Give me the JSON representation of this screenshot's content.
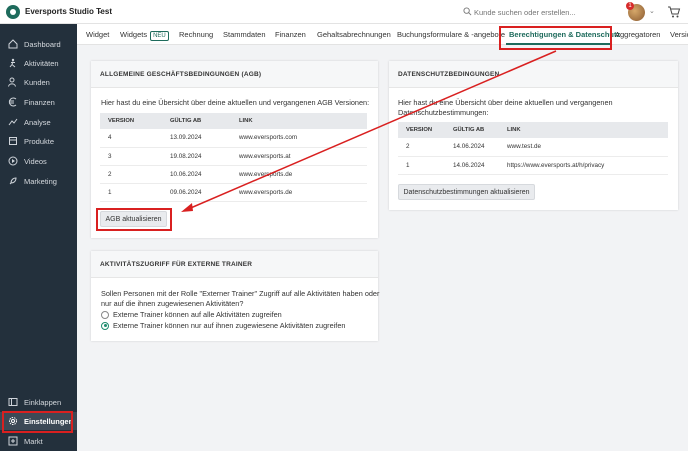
{
  "header": {
    "studio_name": "Eversports Studio Test",
    "search_placeholder": "Kunde suchen oder erstellen...",
    "notification_count": "1"
  },
  "sidebar": {
    "items": [
      {
        "label": "Dashboard",
        "icon": "home-icon"
      },
      {
        "label": "Aktivitäten",
        "icon": "activity-icon"
      },
      {
        "label": "Kunden",
        "icon": "users-icon"
      },
      {
        "label": "Finanzen",
        "icon": "euro-icon"
      },
      {
        "label": "Analyse",
        "icon": "chart-icon"
      },
      {
        "label": "Produkte",
        "icon": "box-icon"
      },
      {
        "label": "Videos",
        "icon": "play-icon"
      },
      {
        "label": "Marketing",
        "icon": "rocket-icon"
      }
    ],
    "bottom": [
      {
        "label": "Einklappen",
        "icon": "collapse-icon"
      },
      {
        "label": "Einstellungen",
        "icon": "gear-icon"
      },
      {
        "label": "Markt",
        "icon": "plus-icon"
      }
    ]
  },
  "tabs": [
    {
      "label": "Widget"
    },
    {
      "label": "Widgets",
      "badge": "NEU"
    },
    {
      "label": "Rechnung"
    },
    {
      "label": "Stammdaten"
    },
    {
      "label": "Finanzen"
    },
    {
      "label": "Gehaltsabrechnungen"
    },
    {
      "label": "Buchungsformulare & -angebote"
    },
    {
      "label": "Berechtigungen & Datenschutz"
    },
    {
      "label": "Aggregatoren"
    },
    {
      "label": "Versic"
    }
  ],
  "agb": {
    "title": "ALLGEMEINE GESCHÄFTSBEDINGUNGEN (AGB)",
    "intro": "Hier hast du eine Übersicht über deine aktuellen und vergangenen AGB Versionen:",
    "columns": [
      "VERSION",
      "GÜLTIG AB",
      "LINK"
    ],
    "rows": [
      [
        "4",
        "13.09.2024",
        "www.eversports.com"
      ],
      [
        "3",
        "19.08.2024",
        "www.eversports.at"
      ],
      [
        "2",
        "10.06.2024",
        "www.eversports.de"
      ],
      [
        "1",
        "09.06.2024",
        "www.eversports.de"
      ]
    ],
    "button": "AGB aktualisieren"
  },
  "datenschutz": {
    "title": "DATENSCHUTZBEDINGUNGEN",
    "intro_line1": "Hier hast du eine Übersicht über deine aktuellen und vergangenen",
    "intro_line2": "Datenschutzbestimmungen:",
    "columns": [
      "VERSION",
      "GÜLTIG AB",
      "LINK"
    ],
    "rows": [
      [
        "2",
        "14.06.2024",
        "www.test.de"
      ],
      [
        "1",
        "14.06.2024",
        "https://www.eversports.at/h/privacy"
      ]
    ],
    "button": "Datenschutzbestimmungen aktualisieren"
  },
  "trainer": {
    "title": "AKTIVITÄTSZUGRIFF FÜR EXTERNE TRAINER",
    "question_line1": "Sollen Personen mit der Rolle \"Externer Trainer\" Zugriff auf alle Aktivitäten haben oder",
    "question_line2": "nur auf die ihnen zugewiesenen Aktivitäten?",
    "option_all": "Externe Trainer können auf alle Aktivitäten zugreifen",
    "option_assigned": "Externe Trainer können nur auf ihnen zugewiesene Aktivitäten zugreifen",
    "selected": "assigned"
  },
  "colors": {
    "accent": "#1e6b5c",
    "sidebar_bg": "#23303c",
    "highlight": "#d92020"
  }
}
